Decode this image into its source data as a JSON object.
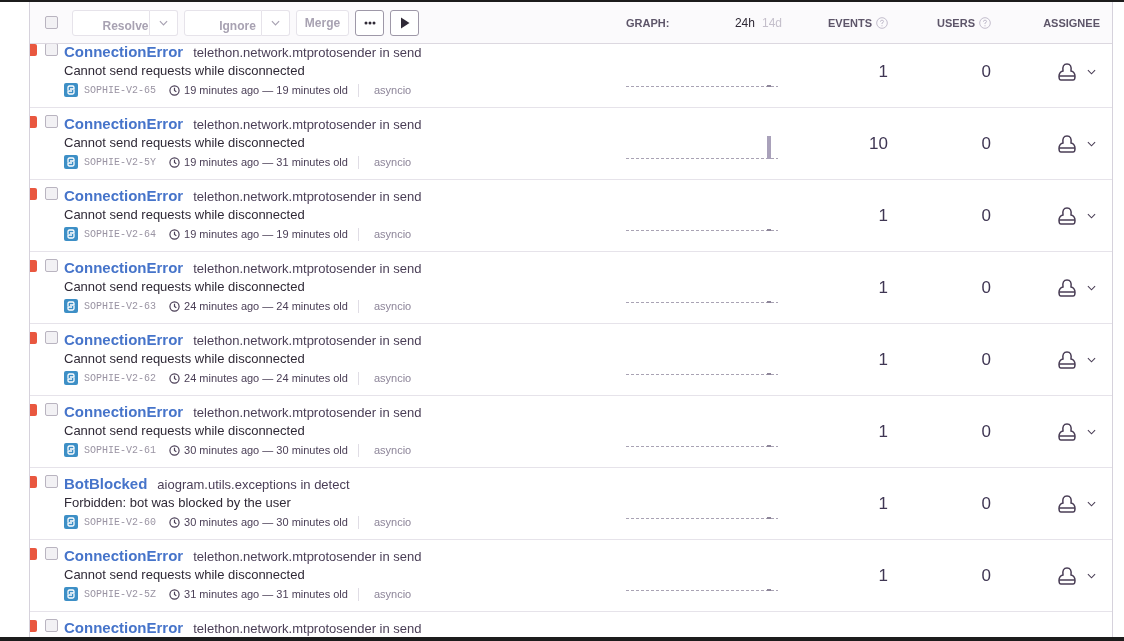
{
  "toolbar": {
    "select_all_checked": false,
    "actions": [
      {
        "kind": "resolve",
        "label": "Resolve",
        "disabled": true
      },
      {
        "kind": "ignore",
        "label": "Ignore",
        "disabled": true
      },
      {
        "kind": "merge",
        "label": "Merge",
        "disabled": true
      },
      {
        "kind": "more",
        "disabled": false
      },
      {
        "kind": "play",
        "disabled": false
      }
    ]
  },
  "graph": {
    "label": "GRAPH:",
    "periods": [
      {
        "label": "24h",
        "selected": true
      },
      {
        "label": "14d",
        "selected": false
      }
    ]
  },
  "columns": [
    {
      "label": "EVENTS",
      "help": true
    },
    {
      "label": "USERS",
      "help": true
    },
    {
      "label": "ASSIGNEE",
      "help": false
    }
  ],
  "issues": [
    {
      "title": "ConnectionError",
      "culprit": "telethon.network.mtprotosender in send",
      "message": "Cannot send requests while disconnected",
      "short_id": "SOPHIE-V2-65",
      "time": "19 minutes ago — 19 minutes old",
      "tag": "asyncio",
      "events": "1",
      "users": "0",
      "checked": false,
      "color": "#e9573f",
      "spike": false
    },
    {
      "title": "ConnectionError",
      "culprit": "telethon.network.mtprotosender in send",
      "message": "Cannot send requests while disconnected",
      "short_id": "SOPHIE-V2-5Y",
      "time": "19 minutes ago — 31 minutes old",
      "tag": "asyncio",
      "events": "10",
      "users": "0",
      "checked": false,
      "color": "#e9573f",
      "spike": true
    },
    {
      "title": "ConnectionError",
      "culprit": "telethon.network.mtprotosender in send",
      "message": "Cannot send requests while disconnected",
      "short_id": "SOPHIE-V2-64",
      "time": "19 minutes ago — 19 minutes old",
      "tag": "asyncio",
      "events": "1",
      "users": "0",
      "checked": false,
      "color": "#e9573f",
      "spike": false
    },
    {
      "title": "ConnectionError",
      "culprit": "telethon.network.mtprotosender in send",
      "message": "Cannot send requests while disconnected",
      "short_id": "SOPHIE-V2-63",
      "time": "24 minutes ago — 24 minutes old",
      "tag": "asyncio",
      "events": "1",
      "users": "0",
      "checked": false,
      "color": "#e9573f",
      "spike": false
    },
    {
      "title": "ConnectionError",
      "culprit": "telethon.network.mtprotosender in send",
      "message": "Cannot send requests while disconnected",
      "short_id": "SOPHIE-V2-62",
      "time": "24 minutes ago — 24 minutes old",
      "tag": "asyncio",
      "events": "1",
      "users": "0",
      "checked": false,
      "color": "#e9573f",
      "spike": false
    },
    {
      "title": "ConnectionError",
      "culprit": "telethon.network.mtprotosender in send",
      "message": "Cannot send requests while disconnected",
      "short_id": "SOPHIE-V2-61",
      "time": "30 minutes ago — 30 minutes old",
      "tag": "asyncio",
      "events": "1",
      "users": "0",
      "checked": false,
      "color": "#e9573f",
      "spike": false
    },
    {
      "title": "BotBlocked",
      "culprit": "aiogram.utils.exceptions in detect",
      "message": "Forbidden: bot was blocked by the user",
      "short_id": "SOPHIE-V2-60",
      "time": "30 minutes ago — 30 minutes old",
      "tag": "asyncio",
      "events": "1",
      "users": "0",
      "checked": false,
      "color": "#e9573f",
      "spike": false
    },
    {
      "title": "ConnectionError",
      "culprit": "telethon.network.mtprotosender in send",
      "message": "Cannot send requests while disconnected",
      "short_id": "SOPHIE-V2-5Z",
      "time": "31 minutes ago — 31 minutes old",
      "tag": "asyncio",
      "events": "1",
      "users": "0",
      "checked": false,
      "color": "#e9573f",
      "spike": false
    },
    {
      "title": "ConnectionError",
      "culprit": "telethon.network.mtprotosender in send",
      "checked": false,
      "color": "#e9573f"
    }
  ]
}
